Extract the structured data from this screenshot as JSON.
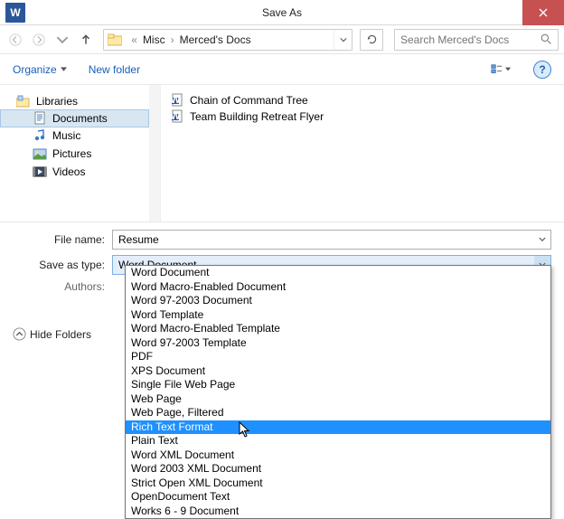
{
  "titlebar": {
    "title": "Save As",
    "app_letter": "W"
  },
  "nav": {
    "breadcrumb": {
      "parent": "Misc",
      "current": "Merced's Docs",
      "ellipsis": "«"
    },
    "search_placeholder": "Search Merced's Docs"
  },
  "toolbar": {
    "organize": "Organize",
    "new_folder": "New folder",
    "help": "?"
  },
  "tree": {
    "libraries": "Libraries",
    "documents": "Documents",
    "music": "Music",
    "pictures": "Pictures",
    "videos": "Videos"
  },
  "files": [
    "Chain of Command Tree",
    "Team Building Retreat Flyer"
  ],
  "form": {
    "file_name_label": "File name:",
    "file_name_value": "Resume",
    "save_type_label": "Save as type:",
    "save_type_value": "Word Document",
    "authors_label": "Authors:"
  },
  "bottom": {
    "hide_folders": "Hide Folders"
  },
  "dropdown": {
    "options": [
      "Word Document",
      "Word Macro-Enabled Document",
      "Word 97-2003 Document",
      "Word Template",
      "Word Macro-Enabled Template",
      "Word 97-2003 Template",
      "PDF",
      "XPS Document",
      "Single File Web Page",
      "Web Page",
      "Web Page, Filtered",
      "Rich Text Format",
      "Plain Text",
      "Word XML Document",
      "Word 2003 XML Document",
      "Strict Open XML Document",
      "OpenDocument Text",
      "Works 6 - 9 Document"
    ],
    "selected_index": 11
  }
}
